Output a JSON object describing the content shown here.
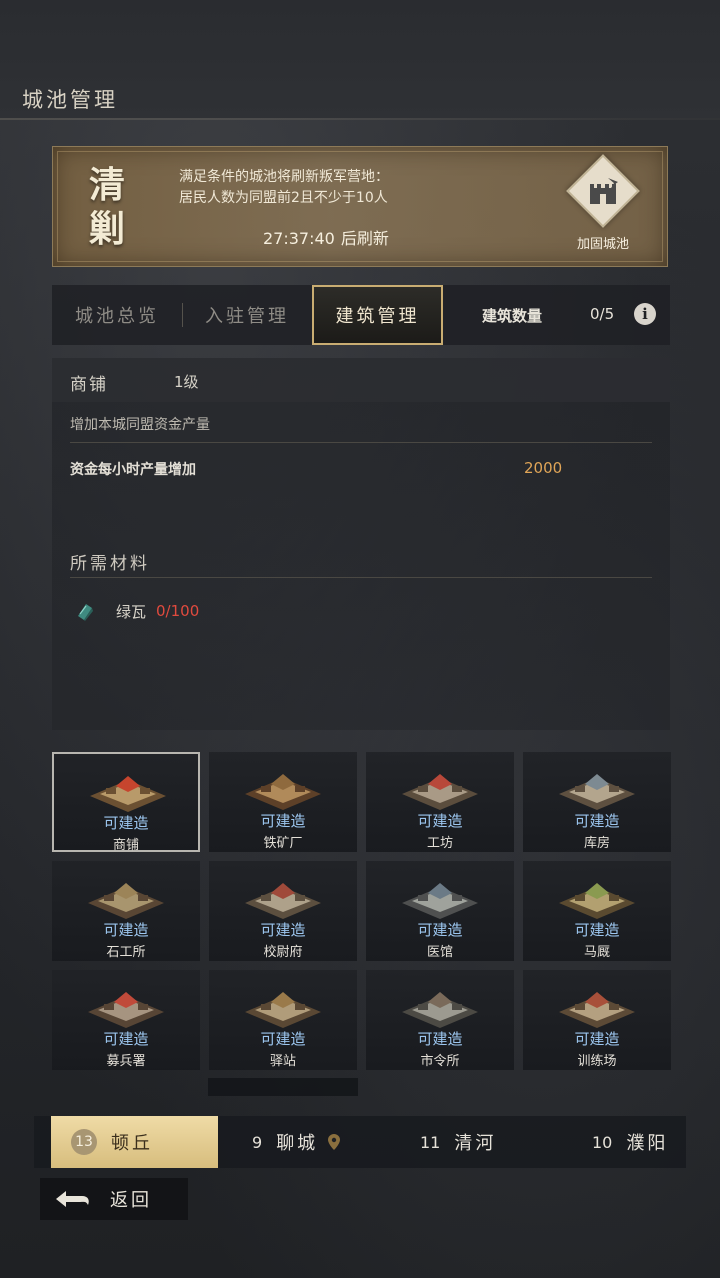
{
  "header": {
    "title": "城池管理"
  },
  "banner": {
    "seal": "清剿",
    "line1": "满足条件的城池将刷新叛军营地：",
    "line2": "居民人数为同盟前2且不少于10人",
    "timer": "27:37:40",
    "timer_suffix": "后刷新",
    "fortify_label": "加固城池",
    "fortify_icon": "fortify-castle-icon"
  },
  "tabs": [
    {
      "label": "城池总览",
      "active": false
    },
    {
      "label": "入驻管理",
      "active": false
    },
    {
      "label": "建筑管理",
      "active": true
    }
  ],
  "building_count": {
    "label": "建筑数量",
    "value": "0/5",
    "info_icon": "info-icon"
  },
  "detail": {
    "name": "商铺",
    "level": "1级",
    "description": "增加本城同盟资金产量",
    "stat_label": "资金每小时产量增加",
    "stat_value": "2000",
    "stat_color": "#e0a557",
    "materials_title": "所需材料",
    "material": {
      "name": "绿瓦",
      "qty": "0/100",
      "qty_color": "#e04a3e",
      "icon": "green-tile-icon"
    }
  },
  "buildings": [
    {
      "name": "商铺",
      "status": "可建造",
      "selected": true
    },
    {
      "name": "铁矿厂",
      "status": "可建造",
      "selected": false
    },
    {
      "name": "工坊",
      "status": "可建造",
      "selected": false
    },
    {
      "name": "库房",
      "status": "可建造",
      "selected": false
    },
    {
      "name": "石工所",
      "status": "可建造",
      "selected": false
    },
    {
      "name": "校尉府",
      "status": "可建造",
      "selected": false
    },
    {
      "name": "医馆",
      "status": "可建造",
      "selected": false
    },
    {
      "name": "马厩",
      "status": "可建造",
      "selected": false
    },
    {
      "name": "募兵署",
      "status": "可建造",
      "selected": false
    },
    {
      "name": "驿站",
      "status": "可建造",
      "selected": false
    },
    {
      "name": "市令所",
      "status": "可建造",
      "selected": false
    },
    {
      "name": "训练场",
      "status": "可建造",
      "selected": false
    }
  ],
  "cities": [
    {
      "num": "13",
      "name": "顿丘",
      "active": true
    },
    {
      "num": "9",
      "name": "聊城",
      "active": false,
      "icon": "location-pin-icon"
    },
    {
      "num": "11",
      "name": "清河",
      "active": false
    },
    {
      "num": "10",
      "name": "濮阳",
      "active": false
    }
  ],
  "back": {
    "label": "返回",
    "icon": "back-arrow-icon"
  },
  "colors": {
    "accent_gold": "#c9ad72",
    "status_blue": "#9cc6ef"
  }
}
